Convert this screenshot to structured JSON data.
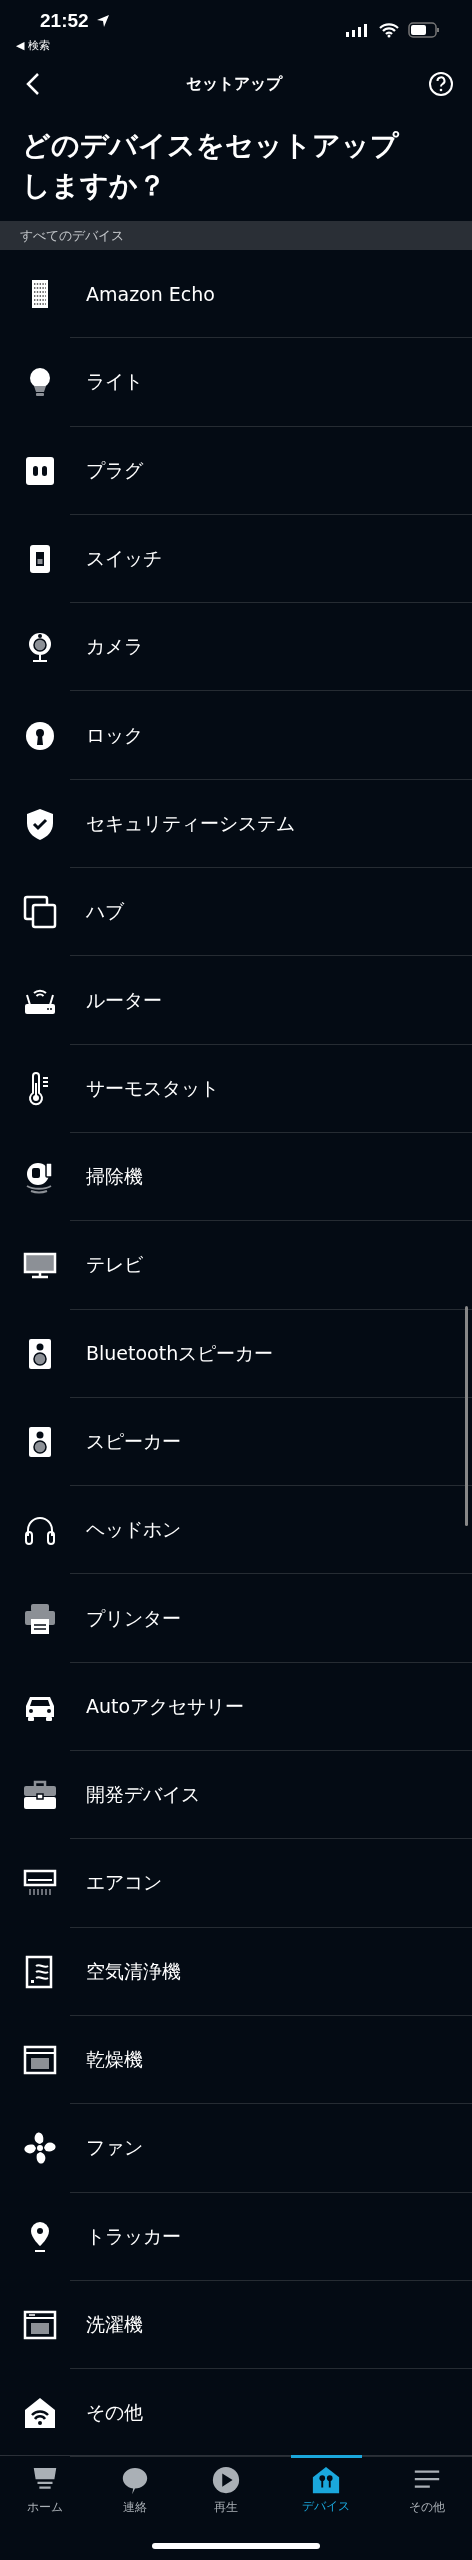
{
  "status_bar": {
    "time": "21:52",
    "back_link": "◀ 検索"
  },
  "nav_bar": {
    "title": "セットアップ"
  },
  "heading": "どのデバイスをセットアップしますか？",
  "section": {
    "title": "すべてのデバイス"
  },
  "devices": [
    {
      "kind": "echo",
      "label": "Amazon Echo"
    },
    {
      "kind": "bulb",
      "label": "ライト"
    },
    {
      "kind": "outlet",
      "label": "プラグ"
    },
    {
      "kind": "switch",
      "label": "スイッチ"
    },
    {
      "kind": "camera",
      "label": "カメラ"
    },
    {
      "kind": "lock",
      "label": "ロック"
    },
    {
      "kind": "shield",
      "label": "セキュリティーシステム"
    },
    {
      "kind": "hub",
      "label": "ハブ"
    },
    {
      "kind": "router",
      "label": "ルーター"
    },
    {
      "kind": "thermo",
      "label": "サーモスタット"
    },
    {
      "kind": "vacuum",
      "label": "掃除機"
    },
    {
      "kind": "tv",
      "label": "テレビ"
    },
    {
      "kind": "speaker",
      "label": "Bluetoothスピーカー"
    },
    {
      "kind": "speaker",
      "label": "スピーカー"
    },
    {
      "kind": "headphones",
      "label": "ヘッドホン"
    },
    {
      "kind": "printer",
      "label": "プリンター"
    },
    {
      "kind": "car",
      "label": "Autoアクセサリー"
    },
    {
      "kind": "toolbox",
      "label": "開発デバイス"
    },
    {
      "kind": "ac",
      "label": "エアコン"
    },
    {
      "kind": "purifier",
      "label": "空気清浄機"
    },
    {
      "kind": "dryer",
      "label": "乾燥機"
    },
    {
      "kind": "fan",
      "label": "ファン"
    },
    {
      "kind": "pin",
      "label": "トラッカー"
    },
    {
      "kind": "washer",
      "label": "洗濯機"
    },
    {
      "kind": "other",
      "label": "その他"
    }
  ],
  "tab_bar": [
    {
      "kind": "home",
      "label": "ホーム",
      "selected": false
    },
    {
      "kind": "chat",
      "label": "連絡",
      "selected": false
    },
    {
      "kind": "play",
      "label": "再生",
      "selected": false
    },
    {
      "kind": "devices",
      "label": "デバイス",
      "selected": true
    },
    {
      "kind": "more",
      "label": "その他",
      "selected": false
    }
  ]
}
